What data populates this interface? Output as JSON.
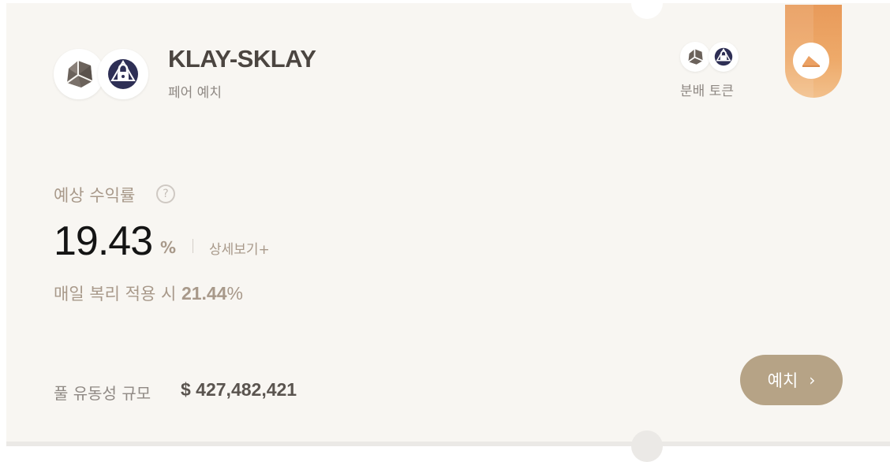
{
  "pair": {
    "title": "KLAY-SKLAY",
    "subtitle": "페어 예치",
    "tokens": [
      "klay-icon",
      "sklay-icon"
    ]
  },
  "distribution": {
    "label": "분배 토큰",
    "tokens": [
      "klay-icon",
      "sklay-icon"
    ]
  },
  "badge": {
    "icon": "cheese-icon",
    "color": "#eba164"
  },
  "apr": {
    "label": "예상 수익률",
    "help_glyph": "?",
    "value": "19.43",
    "unit": "%",
    "detail_link": "상세보기+"
  },
  "compound": {
    "prefix": "매일 복리 적용 시",
    "value": "21.44",
    "unit": "%"
  },
  "pool": {
    "label": "풀 유동성 규모",
    "value": "$ 427,482,421"
  },
  "deposit_button": {
    "label": "예치",
    "chevron": "›"
  },
  "colors": {
    "card_bg": "#f8f6f2",
    "accent_tan": "#b6a386",
    "muted_tan": "#a8998a",
    "ribbon_orange": "#eba164",
    "sklay_navy": "#2e2f55"
  }
}
